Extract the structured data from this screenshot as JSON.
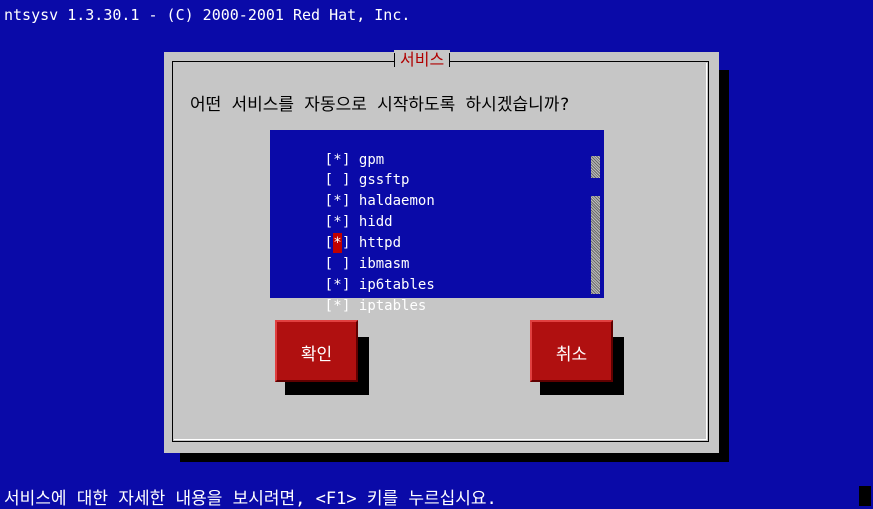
{
  "title_bar": "ntsysv 1.3.30.1 - (C) 2000-2001 Red Hat, Inc.",
  "dialog": {
    "title": "서비스",
    "prompt": "어떤 서비스를 자동으로 시작하도록 하시겠습니까?"
  },
  "services": [
    {
      "checked": "*",
      "name": "gpm"
    },
    {
      "checked": " ",
      "name": "gssftp"
    },
    {
      "checked": "*",
      "name": "haldaemon"
    },
    {
      "checked": "*",
      "name": "hidd"
    },
    {
      "checked": "*",
      "name": "httpd"
    },
    {
      "checked": " ",
      "name": "ibmasm"
    },
    {
      "checked": "*",
      "name": "ip6tables"
    },
    {
      "checked": "*",
      "name": "iptables"
    }
  ],
  "checkbox": {
    "open": "[",
    "close": "]"
  },
  "focused_index": 4,
  "buttons": {
    "ok": "확인",
    "cancel": "취소"
  },
  "status_bar": "서비스에 대한 자세한 내용을 보시려면, <F1> 키를 누르십시요.",
  "colors": {
    "background": "#0a0aa8",
    "dialog": "#c6c6c6",
    "accent_red": "#b01010",
    "title_red": "#b00000"
  }
}
